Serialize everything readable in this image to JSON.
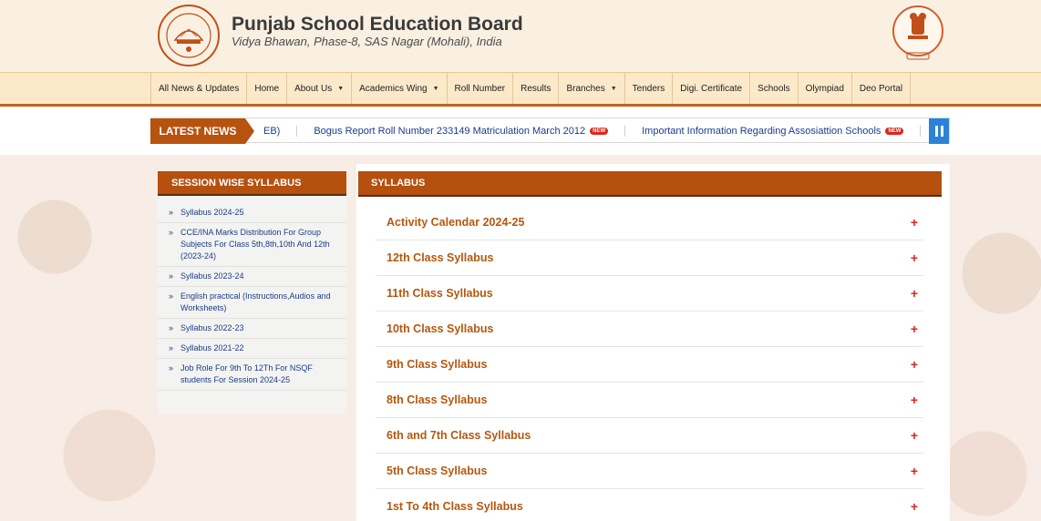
{
  "header": {
    "title": "Punjab School Education Board",
    "subtitle": "Vidya Bhawan, Phase-8, SAS Nagar (Mohali), India"
  },
  "nav": {
    "items": [
      {
        "label": "All News & Updates",
        "dropdown": false
      },
      {
        "label": "Home",
        "dropdown": false
      },
      {
        "label": "About Us",
        "dropdown": true
      },
      {
        "label": "Academics Wing",
        "dropdown": true
      },
      {
        "label": "Roll Number",
        "dropdown": false
      },
      {
        "label": "Results",
        "dropdown": false
      },
      {
        "label": "Branches",
        "dropdown": true
      },
      {
        "label": "Tenders",
        "dropdown": false
      },
      {
        "label": "Digi. Certificate",
        "dropdown": false
      },
      {
        "label": "Schools",
        "dropdown": false
      },
      {
        "label": "Olympiad",
        "dropdown": false
      },
      {
        "label": "Deo Portal",
        "dropdown": false
      }
    ]
  },
  "ticker": {
    "label": "LATEST NEWS",
    "items": [
      {
        "text": "EB)",
        "new": false
      },
      {
        "text": "Bogus Report Roll Number 233149 Matriculation March 2012",
        "new": true
      },
      {
        "text": "Important Information Regarding Assosiattion Schools",
        "new": true
      }
    ],
    "new_badge": "NEW"
  },
  "sidebar": {
    "title": "SESSION WISE SYLLABUS",
    "bullet": "»",
    "items": [
      "Syllabus 2024-25",
      "CCE/INA Marks Distribution For Group Subjects For Class 5th,8th,10th And 12th (2023-24)",
      "Syllabus 2023-24",
      "English practical (Instructions,Audios and Worksheets)",
      "Syllabus 2022-23",
      "Syllabus 2021-22",
      "Job Role For 9th To 12Th For NSQF students For Session 2024-25"
    ]
  },
  "main": {
    "title": "SYLLABUS",
    "plus": "+",
    "items": [
      "Activity Calendar 2024-25",
      "12th Class Syllabus",
      "11th Class Syllabus",
      "10th Class Syllabus",
      "9th Class Syllabus",
      "8th Class Syllabus",
      "6th and 7th Class Syllabus",
      "5th Class Syllabus",
      "1st To 4th Class Syllabus"
    ]
  },
  "colors": {
    "brand": "#b5500f",
    "link": "#1a3c8c",
    "accordion_title": "#b5570f",
    "plus": "#e0241c",
    "pause": "#2a83d8"
  }
}
